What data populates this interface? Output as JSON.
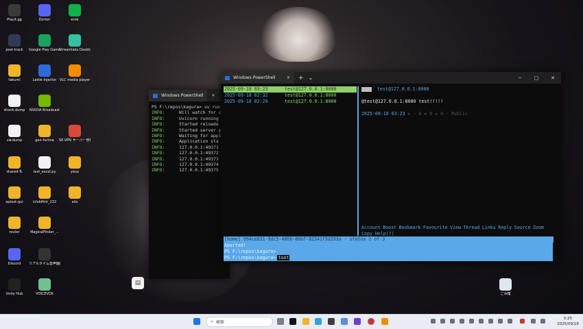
{
  "desktop_icons": [
    {
      "label": "Playit.gg",
      "icon": "playit-icon",
      "color": "#3a3a3a"
    },
    {
      "label": "Dorion",
      "icon": "dorion-icon",
      "color": "#5865f2"
    },
    {
      "label": "ente",
      "icon": "ente-icon",
      "color": "#0fb34a"
    },
    {
      "label": "post-track",
      "icon": "post-track-icon",
      "color": "#2f3b55"
    },
    {
      "label": "Google Play Games (ベータ)",
      "icon": "google-play-games-icon",
      "color": "#1aa260"
    },
    {
      "label": "Streamlabs Desktop",
      "icon": "streamlabs-icon",
      "color": "#31c3a2"
    },
    {
      "label": "takumi",
      "icon": "folder-icon",
      "color": "#f0b429"
    },
    {
      "label": "Lattie Injector",
      "icon": "lattie-icon",
      "color": "#2d6bd8"
    },
    {
      "label": "VLC media player",
      "icon": "vlc-icon",
      "color": "#f28c00"
    },
    {
      "label": "shonk.dump",
      "icon": "file-icon",
      "color": "#f2f2f2"
    },
    {
      "label": "NVIDIA Broadcast",
      "icon": "nvidia-icon",
      "color": "#76b900"
    },
    {
      "label": "vw.dump",
      "icon": "file-icon",
      "color": "#f2f2f2"
    },
    {
      "label": "gen-furima",
      "icon": "folder-icon",
      "color": "#f0b429"
    },
    {
      "label": "SE-VPN サーバー管理 (ツール)",
      "icon": "softether-icon",
      "color": "#d84a38"
    },
    {
      "label": "shared-Tc",
      "icon": "folder-icon",
      "color": "#f0b429"
    },
    {
      "label": "test_excel.py",
      "icon": "python-file-icon",
      "color": "#f2f2f2"
    },
    {
      "label": "yeux",
      "icon": "folder-icon",
      "color": "#f0b429"
    },
    {
      "label": "aptest-gui",
      "icon": "folder-icon",
      "color": "#f0b429"
    },
    {
      "label": "ichddfmt_232",
      "icon": "folder-icon",
      "color": "#f0b429"
    },
    {
      "label": "aiio",
      "icon": "folder-icon",
      "color": "#f0b429"
    },
    {
      "label": "router",
      "icon": "folder-icon",
      "color": "#f0b429"
    },
    {
      "label": "MagicalFinder_...",
      "icon": "folder-icon",
      "color": "#f0b429"
    },
    {
      "label": "Discord",
      "icon": "discord-icon",
      "color": "#5865f2"
    },
    {
      "label": "リアルタイム音声翻訳",
      "icon": "realtime-translate-icon",
      "color": "#333333"
    },
    {
      "label": "Unity Hub",
      "icon": "unity-icon",
      "color": "#222222"
    },
    {
      "label": "VOICEVOX",
      "icon": "voicevox-icon",
      "color": "#6fc18d"
    },
    {
      "label": "ごみ箱",
      "icon": "recycle-bin-icon",
      "color": "#dfe6ee"
    }
  ],
  "window_back": {
    "title": "Windows PowerShell",
    "lines": [
      {
        "prefix": "PS F:\\repos\\kagura>",
        "text": " uv run"
      },
      {
        "prefix": "INFO:",
        "text": "Will watch for c"
      },
      {
        "prefix": "INFO:",
        "text": "Uvicorn running"
      },
      {
        "prefix": "INFO:",
        "text": "Started reloade"
      },
      {
        "prefix": "INFO:",
        "text": "Started server p"
      },
      {
        "prefix": "INFO:",
        "text": "Waiting for appl"
      },
      {
        "prefix": "INFO:",
        "text": "Application sta"
      },
      {
        "prefix": "INFO:",
        "text": "127.0.0.1:49371"
      },
      {
        "prefix": "INFO:",
        "text": "127.0.0.1:49372"
      },
      {
        "prefix": "INFO:",
        "text": "127.0.0.1:49373"
      },
      {
        "prefix": "INFO:",
        "text": "127.0.0.1:49374"
      },
      {
        "prefix": "INFO:",
        "text": "127.0.0.1:49375"
      }
    ]
  },
  "window_front": {
    "title": "Windows PowerShell",
    "new_tab": "+",
    "dropdown": "⌄",
    "list": [
      {
        "date": "2025-09-18 03:23",
        "user": "test@127.0.0.1:8000",
        "selected": true
      },
      {
        "date": "2025-09-18 02:32",
        "user": "test@127.0.0.1:8000",
        "selected": false
      },
      {
        "date": "2025-09-18 02:29",
        "user": "test@127.0.0.1:8000",
        "selected": false
      }
    ],
    "detail": {
      "header_user": "test@127.0.0.1:8000",
      "content": "@test@127.0.0.1:8000 test!!!!!",
      "meta_date": "2025-09-18 03:23",
      "meta_rest": " ↳ - 0 ⇆ 0 ★ 0 · Public"
    },
    "menu": [
      "Account",
      "Boost",
      "Bookmark",
      "Favourite",
      "View",
      "Thread",
      "Links",
      "Reply",
      "Source",
      "Zoom"
    ],
    "menu_line2": "Copy Help(?)",
    "status_line": "[home] 994ce831-9dc5-4866-80b7-82341f5d293a - status 1 of 3",
    "shell_lines": [
      "Aborted!",
      "PS F:\\repos\\kagura>"
    ],
    "prompt": "PS F:\\repos\\kagura>",
    "command": "toot"
  },
  "taskbar": {
    "search_placeholder": "検索",
    "clock_time": "5:25",
    "clock_date": "2025/09/18"
  },
  "colors": {
    "accent": "#5aa8e8",
    "green": "#88d868",
    "selected_bg": "#8fd16a"
  }
}
